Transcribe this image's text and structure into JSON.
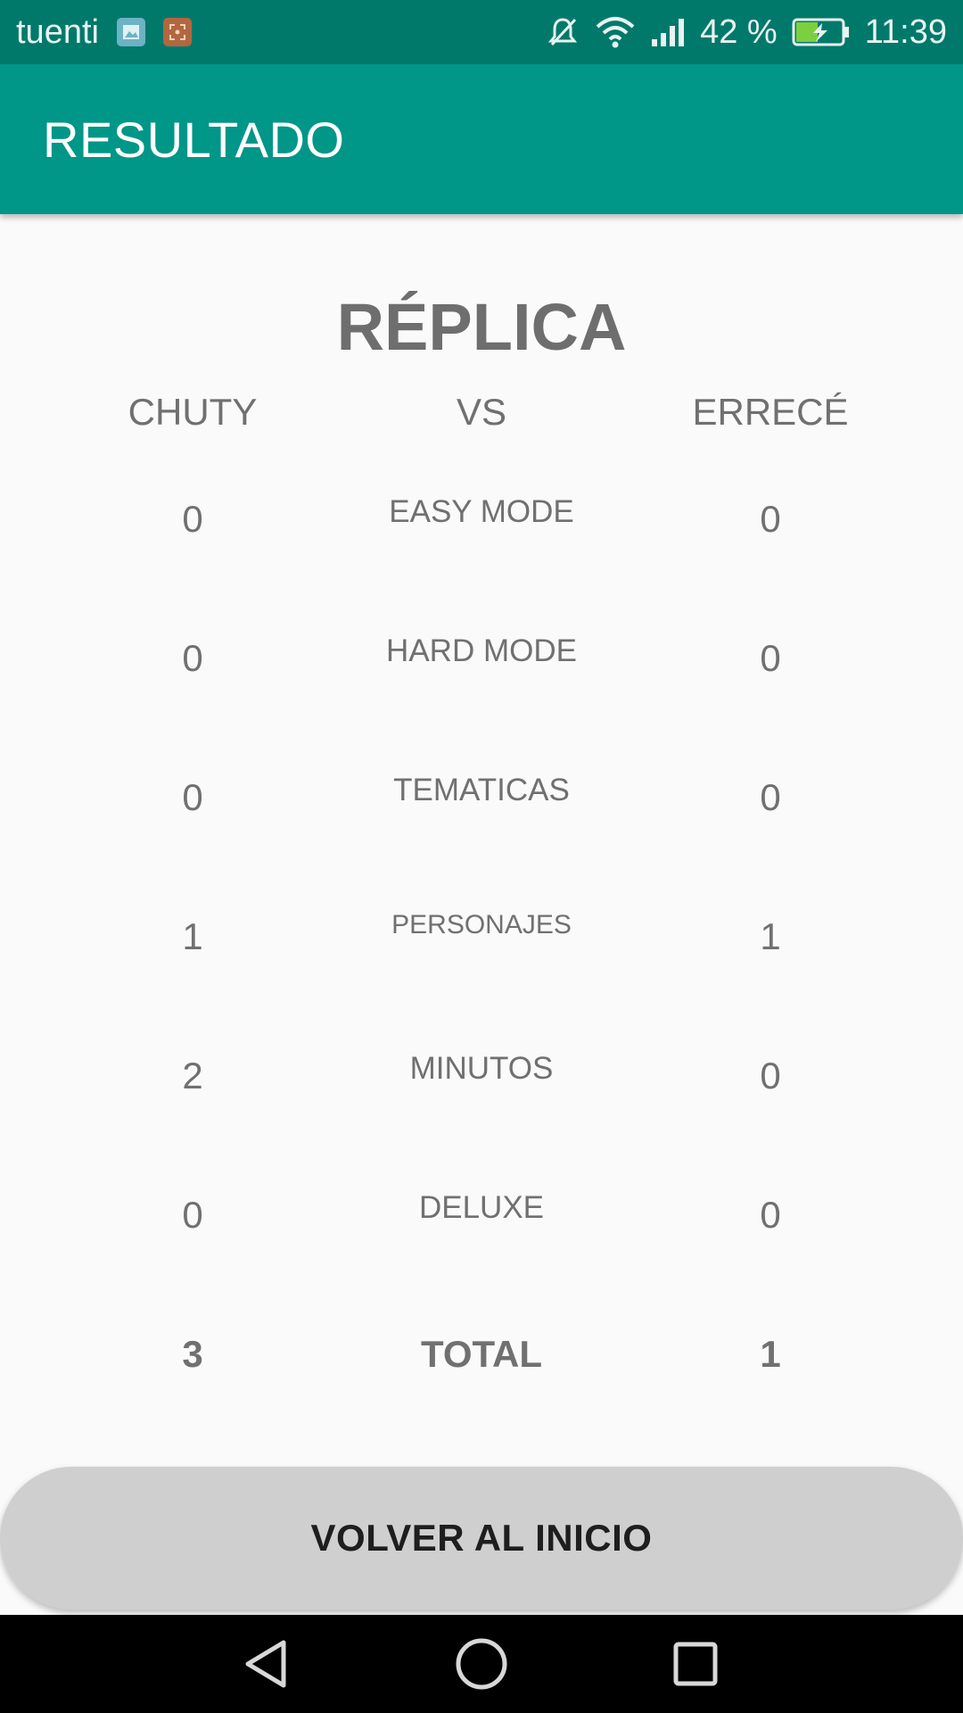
{
  "status_bar": {
    "carrier": "tuenti",
    "battery_percent": "42 %",
    "time": "11:39",
    "icons": [
      "image-notification-icon",
      "screenshot-notification-icon",
      "mute-icon",
      "wifi-icon",
      "signal-icon",
      "battery-charging-icon"
    ]
  },
  "app_bar": {
    "title": "RESULTADO"
  },
  "match": {
    "title": "RÉPLICA",
    "player_left": "CHUTY",
    "vs": "VS",
    "player_right": "ERRECÉ",
    "rows": [
      {
        "label": "EASY MODE",
        "left": "0",
        "right": "0"
      },
      {
        "label": "HARD MODE",
        "left": "0",
        "right": "0"
      },
      {
        "label": "TEMATICAS",
        "left": "0",
        "right": "0"
      },
      {
        "label": "PERSONAJES",
        "left": "1",
        "right": "1"
      },
      {
        "label": "MINUTOS",
        "left": "2",
        "right": "0"
      },
      {
        "label": "DELUXE",
        "left": "0",
        "right": "0"
      }
    ],
    "total": {
      "label": "TOTAL",
      "left": "3",
      "right": "1"
    }
  },
  "button": {
    "label": "VOLVER AL INICIO"
  },
  "nav": {
    "icons": [
      "back-icon",
      "home-icon",
      "recents-icon"
    ]
  },
  "colors": {
    "status_bar": "#00796b",
    "app_bar": "#009688",
    "button": "#d0cfd0"
  }
}
